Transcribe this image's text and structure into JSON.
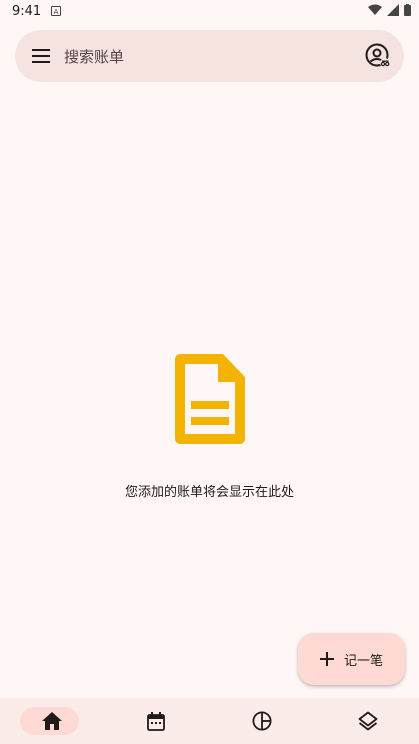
{
  "status_bar": {
    "time": "9:41",
    "notification": "A"
  },
  "search": {
    "placeholder": "搜索账单"
  },
  "empty_state": {
    "message": "您添加的账单将会显示在此处",
    "icon": "document-icon",
    "icon_color": "#f2b400"
  },
  "fab": {
    "label": "记一笔",
    "icon": "plus-icon"
  },
  "bottom_nav": {
    "items": [
      {
        "name": "home",
        "icon": "home-icon",
        "selected": true
      },
      {
        "name": "calendar",
        "icon": "calendar-icon",
        "selected": false
      },
      {
        "name": "statistics",
        "icon": "pie-chart-icon",
        "selected": false
      },
      {
        "name": "layers",
        "icon": "layers-icon",
        "selected": false
      }
    ]
  },
  "colors": {
    "background": "#fff7f5",
    "surface": "#f5e3e0",
    "accent_container": "#ffdad5",
    "doc_icon": "#f2b400"
  }
}
